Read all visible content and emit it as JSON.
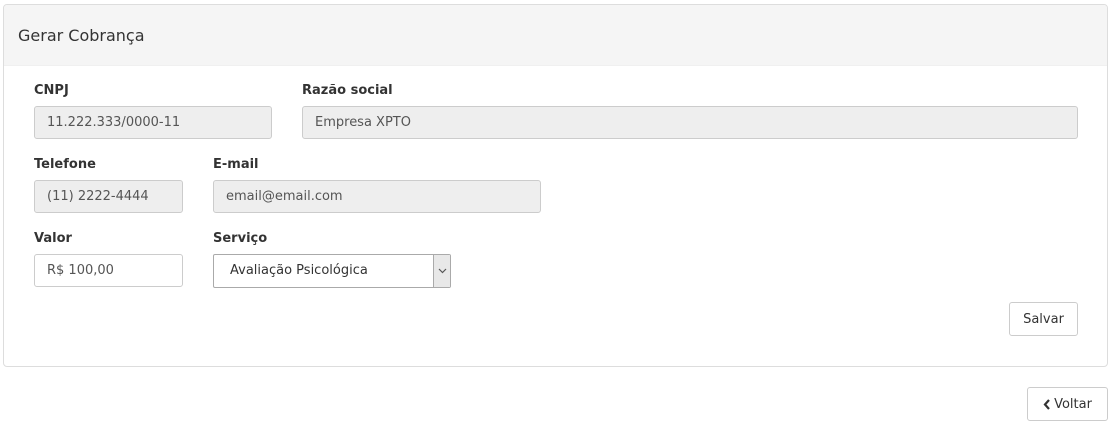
{
  "panel": {
    "title": "Gerar Cobrança"
  },
  "form": {
    "cnpj": {
      "label": "CNPJ",
      "value": "11.222.333/0000-11"
    },
    "razao_social": {
      "label": "Razão social",
      "value": "Empresa XPTO"
    },
    "telefone": {
      "label": "Telefone",
      "value": "(11) 2222-4444"
    },
    "email": {
      "label": "E-mail",
      "value": "email@email.com"
    },
    "valor": {
      "label": "Valor",
      "value": "R$ 100,00"
    },
    "servico": {
      "label": "Serviço",
      "selected": "Avaliação Psicológica"
    }
  },
  "actions": {
    "save_label": "Salvar",
    "back_label": "Voltar"
  },
  "icons": {
    "back": "chevron-left-icon",
    "dropdown": "chevron-down-icon"
  }
}
